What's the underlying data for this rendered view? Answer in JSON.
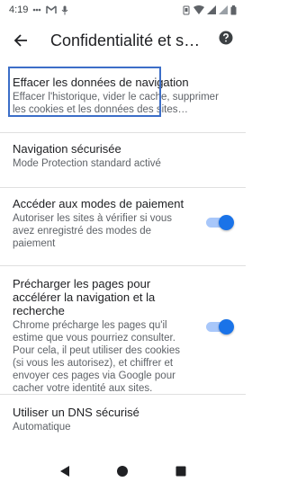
{
  "status_bar": {
    "time": "4:19"
  },
  "toolbar": {
    "title": "Confidentialité et s…"
  },
  "items": [
    {
      "title": "Effacer les données de navigation",
      "summary": "Effacer l'historique, vider le cache, supprimer les cookies et les données des sites…"
    },
    {
      "title": "Navigation sécurisée",
      "summary": "Mode Protection standard activé"
    },
    {
      "title": "Accéder aux modes de paiement",
      "summary": "Autoriser les sites à vérifier si vous avez enregistré des modes de paiement",
      "toggle_on": true
    },
    {
      "title": "Précharger les pages pour accélérer la navigation et la recherche",
      "summary": "Chrome précharge les pages qu'il estime que vous pourriez consulter. Pour cela, il peut utiliser des cookies (si vous les autorisez), et chiffrer et envoyer ces pages via Google pour cacher votre identité aux sites.",
      "toggle_on": true
    },
    {
      "title": "Utiliser un DNS sécurisé",
      "summary": "Automatique"
    }
  ],
  "colors": {
    "accent": "#1a73e8",
    "accent_track": "#a8c7fa",
    "focus": "#3c6ec8"
  }
}
